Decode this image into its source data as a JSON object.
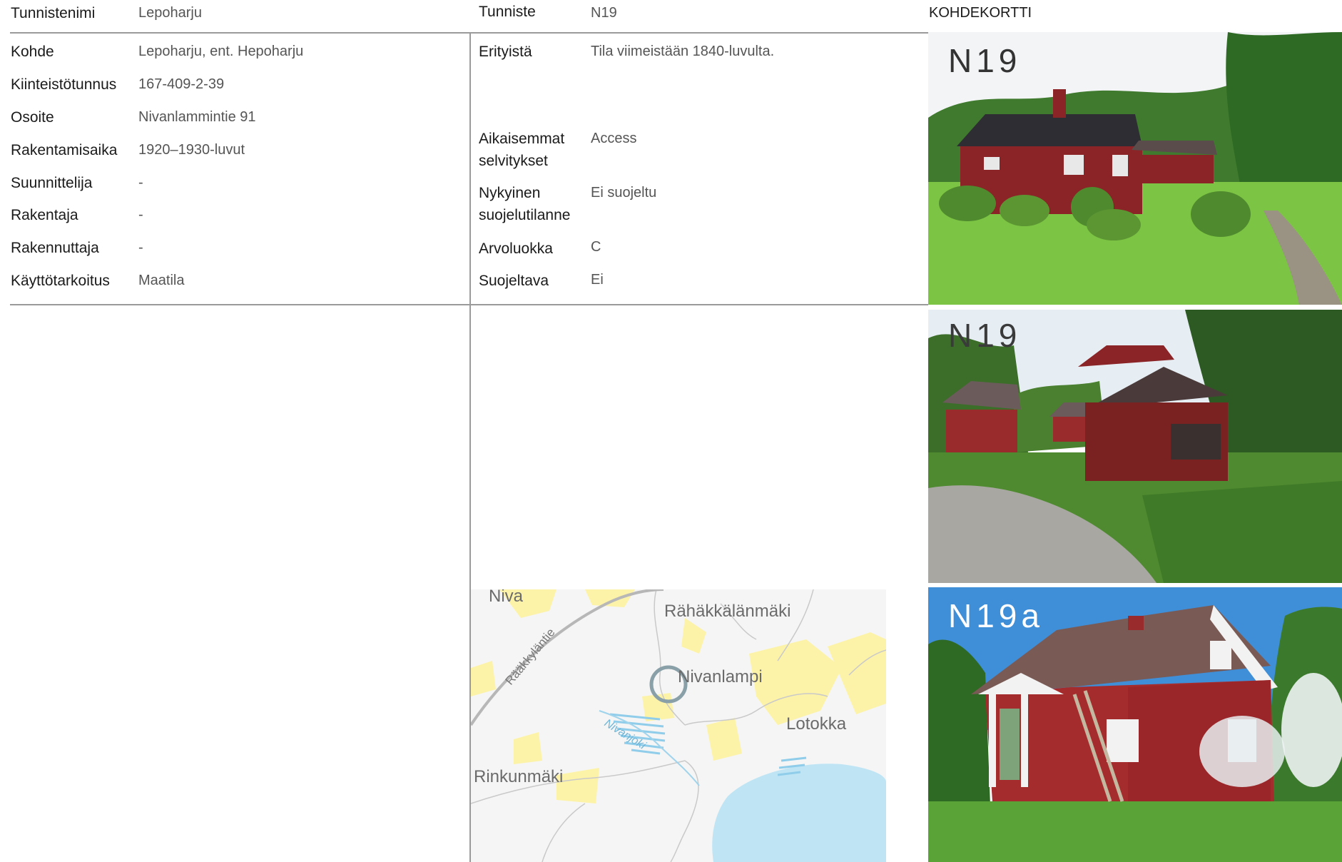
{
  "left": {
    "header_label": "Tunnistenimi",
    "header_value": "Lepoharju",
    "rows": [
      {
        "label": "Kohde",
        "value": "Lepoharju, ent. Hepoharju"
      },
      {
        "label": "Kiinteistötunnus",
        "value": "167-409-2-39"
      },
      {
        "label": "Osoite",
        "value": "Nivanlammintie 91"
      },
      {
        "label": "Rakentamisaika",
        "value": "1920–1930-luvut"
      },
      {
        "label": "Suunnittelija",
        "value": "-"
      },
      {
        "label": "Rakentaja",
        "value": "-"
      },
      {
        "label": "Rakennuttaja",
        "value": "-"
      },
      {
        "label": "Käyttötarkoitus",
        "value": "Maatila"
      }
    ]
  },
  "middle": {
    "header_label": "Tunniste",
    "header_value": "N19",
    "erityista_label": "Erityistä",
    "erityista_value": "Tila viimeistään 1840-luvulta.",
    "aikaisemmat_label_1": "Aikaisemmat",
    "aikaisemmat_label_2": "selvitykset",
    "aikaisemmat_value": "Access",
    "nykyinen_label_1": "Nykyinen",
    "nykyinen_label_2": "suojelutilanne",
    "nykyinen_value": "Ei suojeltu",
    "arvoluokka_label": "Arvoluokka",
    "arvoluokka_value": "C",
    "suojeltava_label": "Suojeltava",
    "suojeltava_value": "Ei"
  },
  "right": {
    "header": "KOHDEKORTTI",
    "photos": [
      {
        "code": "N19",
        "code_color": "#333333"
      },
      {
        "code": "N19",
        "code_color": "#3a3a3a"
      },
      {
        "code": "N19a",
        "code_color": "#ffffff"
      }
    ]
  },
  "map": {
    "places": [
      "Niva",
      "Rähäkkälänmäki",
      "Nivanlampi",
      "Lotokka",
      "Rinkunmäki"
    ],
    "road": "Rääkkyläntie",
    "river": "Nivanjoki",
    "colors": {
      "background": "#f5f5f5",
      "field": "#fdf3a8",
      "water": "#bfe5f5",
      "road": "#b7b7b7",
      "marker": "#8aa0a8"
    }
  }
}
